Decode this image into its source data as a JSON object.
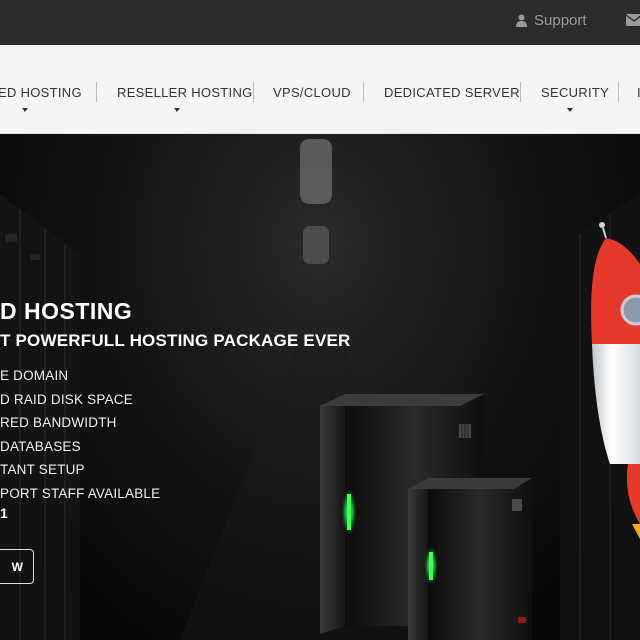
{
  "topbar": {
    "support_label": "Support",
    "icons": [
      "user-icon",
      "mail-icon"
    ]
  },
  "nav": {
    "items": [
      {
        "label": "ED HOSTING",
        "has_dropdown": true
      },
      {
        "label": "RESELLER HOSTING",
        "has_dropdown": true
      },
      {
        "label": "VPS/CLOUD",
        "has_dropdown": false
      },
      {
        "label": "DEDICATED SERVER",
        "has_dropdown": false
      },
      {
        "label": "SECURITY",
        "has_dropdown": true
      },
      {
        "label": "I",
        "has_dropdown": false
      }
    ]
  },
  "hero": {
    "title": "D HOSTING",
    "subtitle": "T POWERFULL HOSTING PACKAGE EVER",
    "features": [
      "E DOMAIN",
      "D RAID DISK SPACE",
      "RED BANDWIDTH",
      "DATABASES",
      "TANT SETUP",
      "PORT STAFF AVAILABLE"
    ],
    "price_fragment": "1",
    "button_label": "W"
  },
  "colors": {
    "topbar_bg": "#2b2b2b",
    "nav_bg": "#f5f5f5",
    "rocket_red": "#e5392c",
    "server_led": "#39d353"
  }
}
